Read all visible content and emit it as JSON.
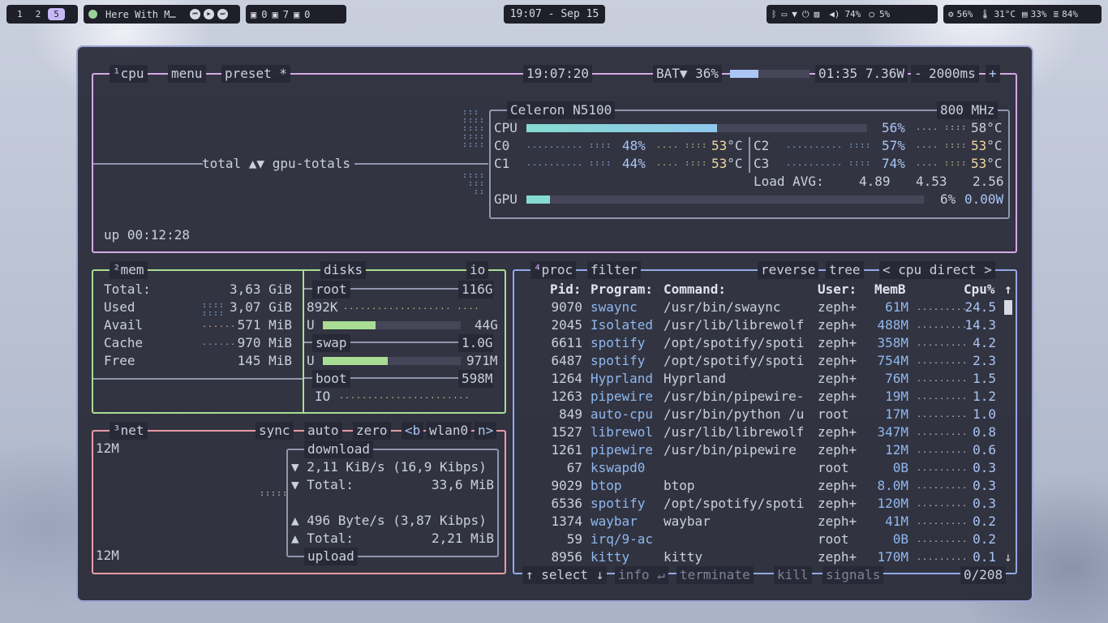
{
  "taskbar": {
    "workspaces": [
      "1",
      "2",
      "5"
    ],
    "media_title": "Here With M…",
    "tray_counts": [
      "0",
      "7",
      "0"
    ],
    "clock": "19:07 - Sep 15",
    "volume": "74%",
    "brightness": "5%",
    "cpu_usage": "56%",
    "temperature": "31°C",
    "memory": "33%",
    "disk": "84%"
  },
  "cpu_box": {
    "tab_num": "¹",
    "tab_cpu": "cpu",
    "tab_menu": "menu",
    "tab_preset": "preset *",
    "time": "19:07:20",
    "battery_label": "BAT▼ 36%",
    "battery_level": 0.36,
    "battery_time": "01:35",
    "battery_watts": "7.36W",
    "interval_minus": "-",
    "interval": "2000ms",
    "interval_plus": "+",
    "graph_label": "total ▲▼ gpu-totals",
    "uptime": "up 00:12:28",
    "cpu_model": "Celeron N5100",
    "freq": "800 MHz",
    "cpu_label": "CPU",
    "cpu_total": 0.56,
    "cpu_total_text": "56%",
    "cpu_temp": "58°C",
    "cores": [
      {
        "name": "C0",
        "pct": "48%",
        "temp": "53",
        "unit": "°C"
      },
      {
        "name": "C2",
        "pct": "57%",
        "temp": "53",
        "unit": "°C"
      },
      {
        "name": "C1",
        "pct": "44%",
        "temp": "53",
        "unit": "°C"
      },
      {
        "name": "C3",
        "pct": "74%",
        "temp": "53",
        "unit": "°C"
      }
    ],
    "load_label": "Load AVG:",
    "load": [
      "4.89",
      "4.53",
      "2.56"
    ],
    "gpu_label": "GPU",
    "gpu_level": 0.06,
    "gpu_pct": "6%",
    "gpu_watts": "0.00W"
  },
  "mem_box": {
    "tab_num": "²",
    "tab_mem": "mem",
    "tab_disks": "disks",
    "tab_io": "io",
    "rows": [
      {
        "label": "Total:",
        "value": "3,63 GiB"
      },
      {
        "label": "Used",
        "value": "3,07 GiB"
      },
      {
        "label": "Avail",
        "value": "571 MiB"
      },
      {
        "label": "Cache",
        "value": "970 MiB"
      },
      {
        "label": "Free",
        "value": "145 MiB"
      }
    ],
    "disks": {
      "root_label": "root",
      "root_size": "116G",
      "root_io": "892K",
      "root_u": "U",
      "root_used": "44G",
      "root_level": 0.38,
      "swap_label": "swap",
      "swap_size": "1.0G",
      "swap_u": "U",
      "swap_used": "971M",
      "swap_level": 0.47,
      "boot_label": "boot",
      "boot_size": "598M",
      "io_label": "IO"
    }
  },
  "net_box": {
    "tab_num": "³",
    "tab_net": "net",
    "tab_sync": "sync",
    "tab_auto": "auto",
    "tab_zero": "zero",
    "tab_prev": "<b",
    "iface": "wlan0",
    "tab_next": "n>",
    "scale_top": "12M",
    "scale_bottom": "12M",
    "download_label": "download",
    "upload_label": "upload",
    "dl_rate": "▼ 2,11 KiB/s (16,9 Kibps)",
    "dl_total_label": "▼ Total:",
    "dl_total": "33,6 MiB",
    "ul_rate": "▲ 496 Byte/s (3,87 Kibps)",
    "ul_total_label": "▲ Total:",
    "ul_total": "2,21 MiB"
  },
  "proc_box": {
    "tab_num": "⁴",
    "tab_proc": "proc",
    "tab_filter": "filter",
    "tab_reverse": "reverse",
    "tab_tree": "tree",
    "tab_sort": "< cpu direct >",
    "headers": {
      "pid": "Pid:",
      "program": "Program:",
      "command": "Command:",
      "user": "User:",
      "mem": "MemB",
      "cpu": "Cpu%"
    },
    "scroll_up": "↑",
    "scroll_down": "↓",
    "rows": [
      {
        "pid": "9070",
        "program": "swaync",
        "command": "/usr/bin/swaync",
        "user": "zeph+",
        "mem": "61M",
        "cpu": "24.5"
      },
      {
        "pid": "2045",
        "program": "Isolated",
        "command": "/usr/lib/librewolf",
        "user": "zeph+",
        "mem": "488M",
        "cpu": "14.3"
      },
      {
        "pid": "6611",
        "program": "spotify",
        "command": "/opt/spotify/spoti",
        "user": "zeph+",
        "mem": "358M",
        "cpu": "4.2"
      },
      {
        "pid": "6487",
        "program": "spotify",
        "command": "/opt/spotify/spoti",
        "user": "zeph+",
        "mem": "754M",
        "cpu": "2.3"
      },
      {
        "pid": "1264",
        "program": "Hyprland",
        "command": "Hyprland",
        "user": "zeph+",
        "mem": "76M",
        "cpu": "1.5"
      },
      {
        "pid": "1263",
        "program": "pipewire",
        "command": "/usr/bin/pipewire-",
        "user": "zeph+",
        "mem": "19M",
        "cpu": "1.2"
      },
      {
        "pid": "849",
        "program": "auto-cpu",
        "command": "/usr/bin/python /u",
        "user": "root",
        "mem": "17M",
        "cpu": "1.0"
      },
      {
        "pid": "1527",
        "program": "librewol",
        "command": "/usr/lib/librewolf",
        "user": "zeph+",
        "mem": "347M",
        "cpu": "0.8"
      },
      {
        "pid": "1261",
        "program": "pipewire",
        "command": "/usr/bin/pipewire",
        "user": "zeph+",
        "mem": "12M",
        "cpu": "0.6"
      },
      {
        "pid": "67",
        "program": "kswapd0",
        "command": "",
        "user": "root",
        "mem": "0B",
        "cpu": "0.3"
      },
      {
        "pid": "9029",
        "program": "btop",
        "command": "btop",
        "user": "zeph+",
        "mem": "8.0M",
        "cpu": "0.3"
      },
      {
        "pid": "6536",
        "program": "spotify",
        "command": "/opt/spotify/spoti",
        "user": "zeph+",
        "mem": "120M",
        "cpu": "0.3"
      },
      {
        "pid": "1374",
        "program": "waybar",
        "command": "waybar",
        "user": "zeph+",
        "mem": "41M",
        "cpu": "0.2"
      },
      {
        "pid": "59",
        "program": "irq/9-ac",
        "command": "",
        "user": "root",
        "mem": "0B",
        "cpu": "0.2"
      },
      {
        "pid": "8956",
        "program": "kitty",
        "command": "kitty",
        "user": "zeph+",
        "mem": "170M",
        "cpu": "0.1"
      }
    ],
    "footer": {
      "select": "↑ select ↓",
      "info": "info ↵",
      "terminate": "terminate",
      "kill": "kill",
      "signals": "signals",
      "count": "0/208"
    }
  }
}
